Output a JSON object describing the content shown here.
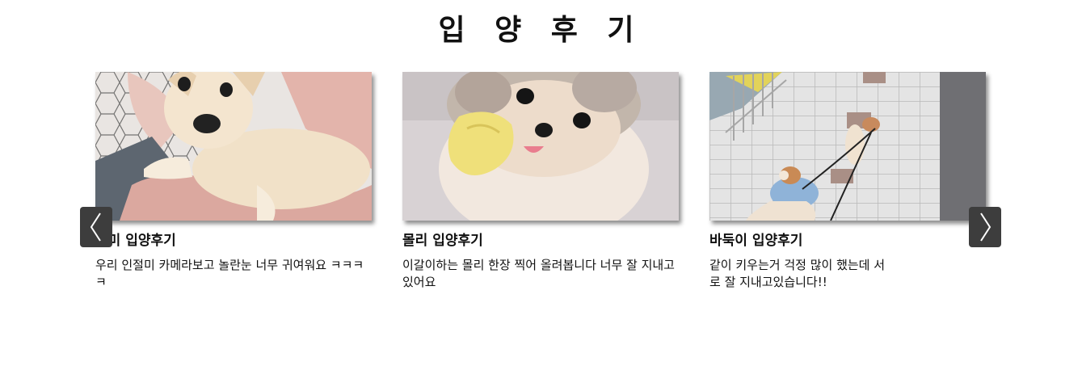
{
  "section": {
    "title": "입 양 후 기"
  },
  "reviews": [
    {
      "title": "절미 입양후기",
      "text": "우리 인절미 카메라보고 놀란눈 너무 귀여워요 ㅋㅋㅋㅋ",
      "image": "cream-chihuahua-puppy-photo"
    },
    {
      "title": "몰리 입양후기",
      "text": "이갈이하는 몰리 한장 찍어 올려봅니다 너무 잘 지내고 있어요",
      "image": "pomeranian-with-yellow-toy-photo"
    },
    {
      "title": "바둑이 입양후기",
      "text": "같이 키우는거 걱정 많이 했는데 서로 잘 지내고있습니다!!",
      "image": "two-dogs-walking-on-tiles-photo"
    }
  ],
  "navigation": {
    "prev_icon": "chevron-left-icon",
    "next_icon": "chevron-right-icon",
    "button_color": "#3d3d3d"
  }
}
